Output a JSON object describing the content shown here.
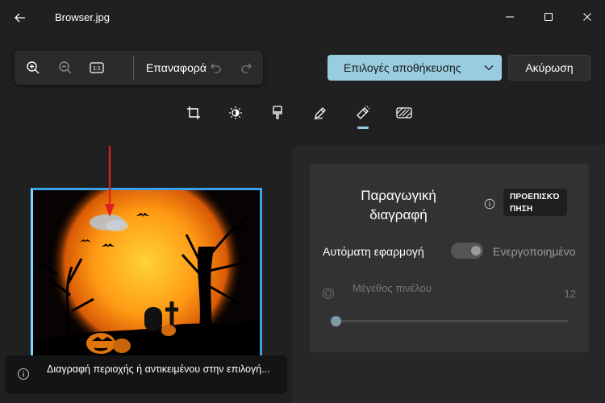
{
  "window": {
    "title": "Browser.jpg",
    "back_icon": "back-arrow-icon",
    "controls": [
      "minimize-icon",
      "maximize-icon",
      "close-icon"
    ]
  },
  "zoom_toolbar": {
    "zoom_in_icon": "zoom-in-icon",
    "zoom_out_icon": "zoom-out-icon",
    "actual_size_label": "1:1",
    "reset_label": "Επαναφορά",
    "undo_icon": "undo-icon",
    "redo_icon": "redo-icon"
  },
  "actions": {
    "save_options_label": "Επιλογές αποθήκευσης",
    "cancel_label": "Ακύρωση"
  },
  "tools": [
    {
      "name": "crop-icon",
      "selected": false
    },
    {
      "name": "adjust-brightness-icon",
      "selected": false
    },
    {
      "name": "markup-brush-icon",
      "selected": false
    },
    {
      "name": "draw-pen-icon",
      "selected": false
    },
    {
      "name": "erase-icon",
      "selected": true
    },
    {
      "name": "background-blur-icon",
      "selected": false
    }
  ],
  "panel": {
    "title": "Παραγωγική διαγραφή",
    "preview_badge": "ΠΡΟΕΠΙΣΚΌ ΠΗΣΗ",
    "auto_apply_label": "Αυτόματη εφαρμογή",
    "auto_apply_state": "Ενεργοποιημένο",
    "brush_size_label": "Μέγεθος πινέλου",
    "brush_size_value": "12"
  },
  "toast": {
    "message": "Διαγραφή περιοχής ή αντικειμένου στην επιλογή..."
  },
  "colors": {
    "accent": "#99ccdf",
    "background": "#202020",
    "panel": "#272727",
    "card": "#323232",
    "selection_border": "#3aa0e8",
    "annotation_arrow": "#e02020"
  }
}
